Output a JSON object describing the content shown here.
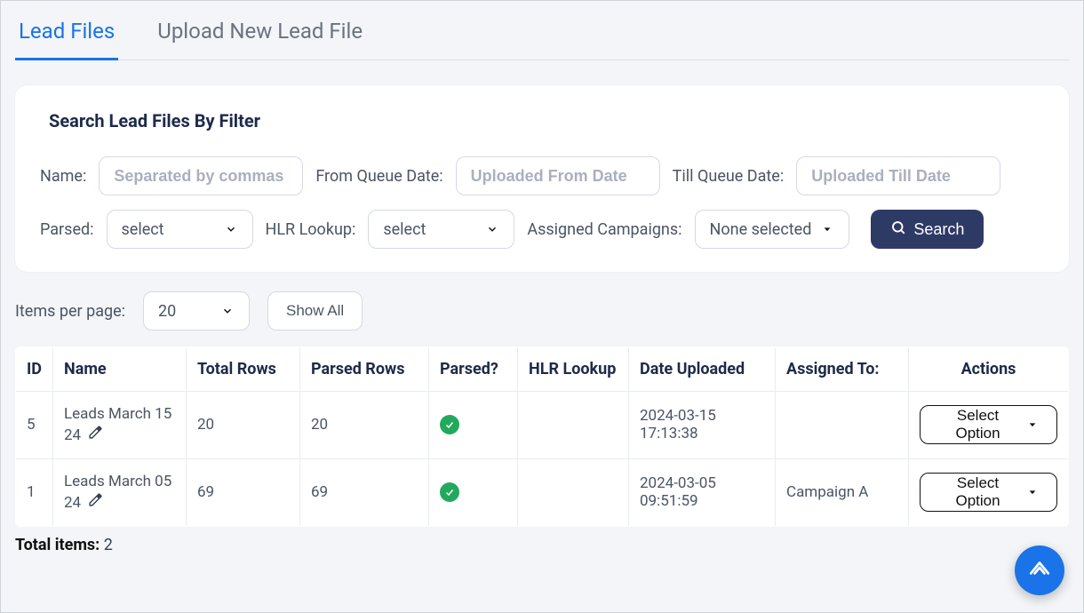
{
  "tabs": {
    "lead_files": "Lead Files",
    "upload_new": "Upload New Lead File"
  },
  "filter": {
    "title": "Search Lead Files By Filter",
    "name_label": "Name:",
    "name_placeholder": "Separated by commas",
    "from_label": "From Queue Date:",
    "from_placeholder": "Uploaded From Date",
    "till_label": "Till Queue Date:",
    "till_placeholder": "Uploaded Till Date",
    "parsed_label": "Parsed:",
    "parsed_value": "select",
    "hlr_label": "HLR Lookup:",
    "hlr_value": "select",
    "campaigns_label": "Assigned Campaigns:",
    "campaigns_value": "None selected",
    "search_btn": "Search"
  },
  "pager": {
    "label": "Items per page:",
    "per_page": "20",
    "show_all": "Show All"
  },
  "table": {
    "headers": {
      "id": "ID",
      "name": "Name",
      "total": "Total Rows",
      "parsed_rows": "Parsed Rows",
      "parsed": "Parsed?",
      "hlr": "HLR Lookup",
      "uploaded": "Date Uploaded",
      "assigned": "Assigned To:",
      "actions": "Actions"
    },
    "rows": [
      {
        "id": "5",
        "name": "Leads March 15 24",
        "total": "20",
        "parsed_rows": "20",
        "parsed": true,
        "hlr": "",
        "uploaded": "2024-03-15 17:13:38",
        "assigned": "",
        "action_label": "Select Option"
      },
      {
        "id": "1",
        "name": "Leads March 05 24",
        "total": "69",
        "parsed_rows": "69",
        "parsed": true,
        "hlr": "",
        "uploaded": "2024-03-05 09:51:59",
        "assigned": "Campaign A",
        "action_label": "Select Option"
      }
    ]
  },
  "totals": {
    "label": "Total items:",
    "count": "2"
  }
}
